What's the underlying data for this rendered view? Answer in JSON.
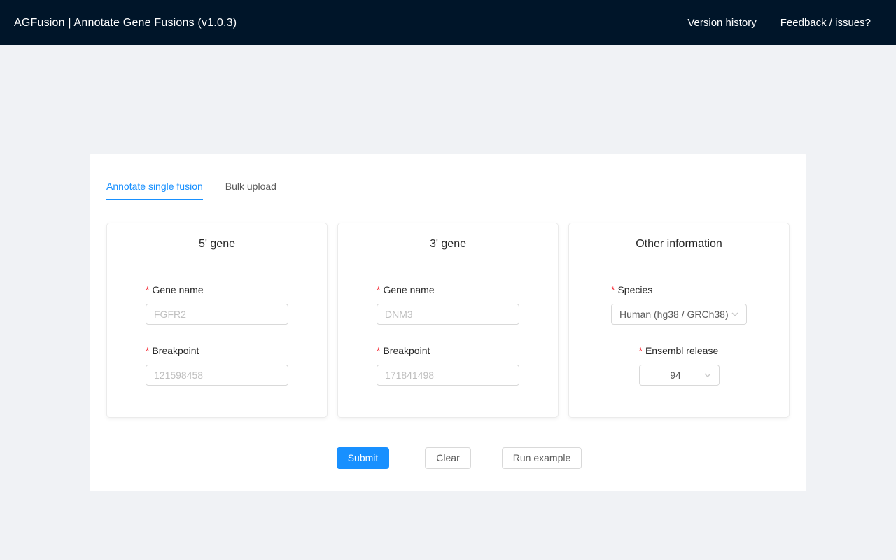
{
  "header": {
    "title": "AGFusion | Annotate Gene Fusions (v1.0.3)",
    "menu": [
      {
        "label": "Version history"
      },
      {
        "label": "Feedback / issues?"
      }
    ]
  },
  "tabs": [
    {
      "label": "Annotate single fusion",
      "active": true
    },
    {
      "label": "Bulk upload",
      "active": false
    }
  ],
  "required_mark": "*",
  "cards": {
    "five_prime": {
      "title": "5' gene",
      "fields": [
        {
          "label": "Gene name",
          "required": true,
          "value": "",
          "placeholder": "FGFR2"
        },
        {
          "label": "Breakpoint",
          "required": true,
          "value": "",
          "placeholder": "121598458"
        }
      ]
    },
    "three_prime": {
      "title": "3' gene",
      "fields": [
        {
          "label": "Gene name",
          "required": true,
          "value": "",
          "placeholder": "DNM3"
        },
        {
          "label": "Breakpoint",
          "required": true,
          "value": "",
          "placeholder": "171841498"
        }
      ]
    },
    "other": {
      "title": "Other information",
      "fields": [
        {
          "label": "Species",
          "required": true,
          "type": "select",
          "value": "Human (hg38 / GRCh38)"
        },
        {
          "label": "Ensembl release",
          "required": true,
          "type": "select",
          "value": "94"
        }
      ]
    }
  },
  "actions": {
    "submit": "Submit",
    "clear": "Clear",
    "run_example": "Run example"
  },
  "colors": {
    "header_bg": "#001529",
    "page_bg": "#f0f2f5",
    "accent": "#1890ff",
    "required": "#f5222d",
    "border": "#d9d9d9",
    "placeholder": "#bfbfbf"
  },
  "icons": {
    "select_arrow": "chevron-down-icon"
  }
}
